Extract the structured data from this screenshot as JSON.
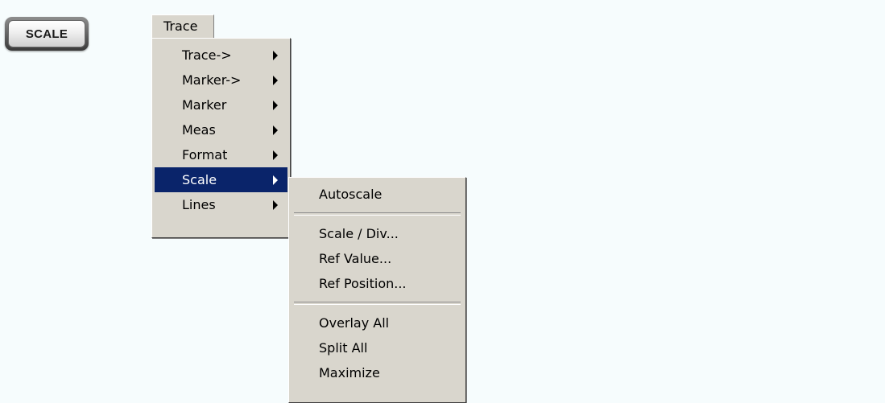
{
  "hardkey": {
    "label": "SCALE"
  },
  "menubar": {
    "trace_label": "Trace"
  },
  "trace_menu": {
    "items": [
      {
        "label": "Trace->",
        "has_submenu": true
      },
      {
        "label": "Marker->",
        "has_submenu": true
      },
      {
        "label": "Marker",
        "has_submenu": true
      },
      {
        "label": "Meas",
        "has_submenu": true
      },
      {
        "label": "Format",
        "has_submenu": true
      },
      {
        "label": "Scale",
        "has_submenu": true,
        "selected": true
      },
      {
        "label": "Lines",
        "has_submenu": true
      }
    ]
  },
  "scale_submenu": {
    "autoscale": "Autoscale",
    "scale_div": "Scale / Div...",
    "ref_value": "Ref Value...",
    "ref_position": "Ref Position...",
    "overlay_all": "Overlay All",
    "split_all": "Split All",
    "maximize": "Maximize"
  },
  "colors": {
    "menu_background": "#d9d6cd",
    "selection_background": "#0a246a",
    "page_background": "#f6fcfd"
  },
  "icons": {
    "submenu_arrow": "submenu-arrow-icon"
  }
}
